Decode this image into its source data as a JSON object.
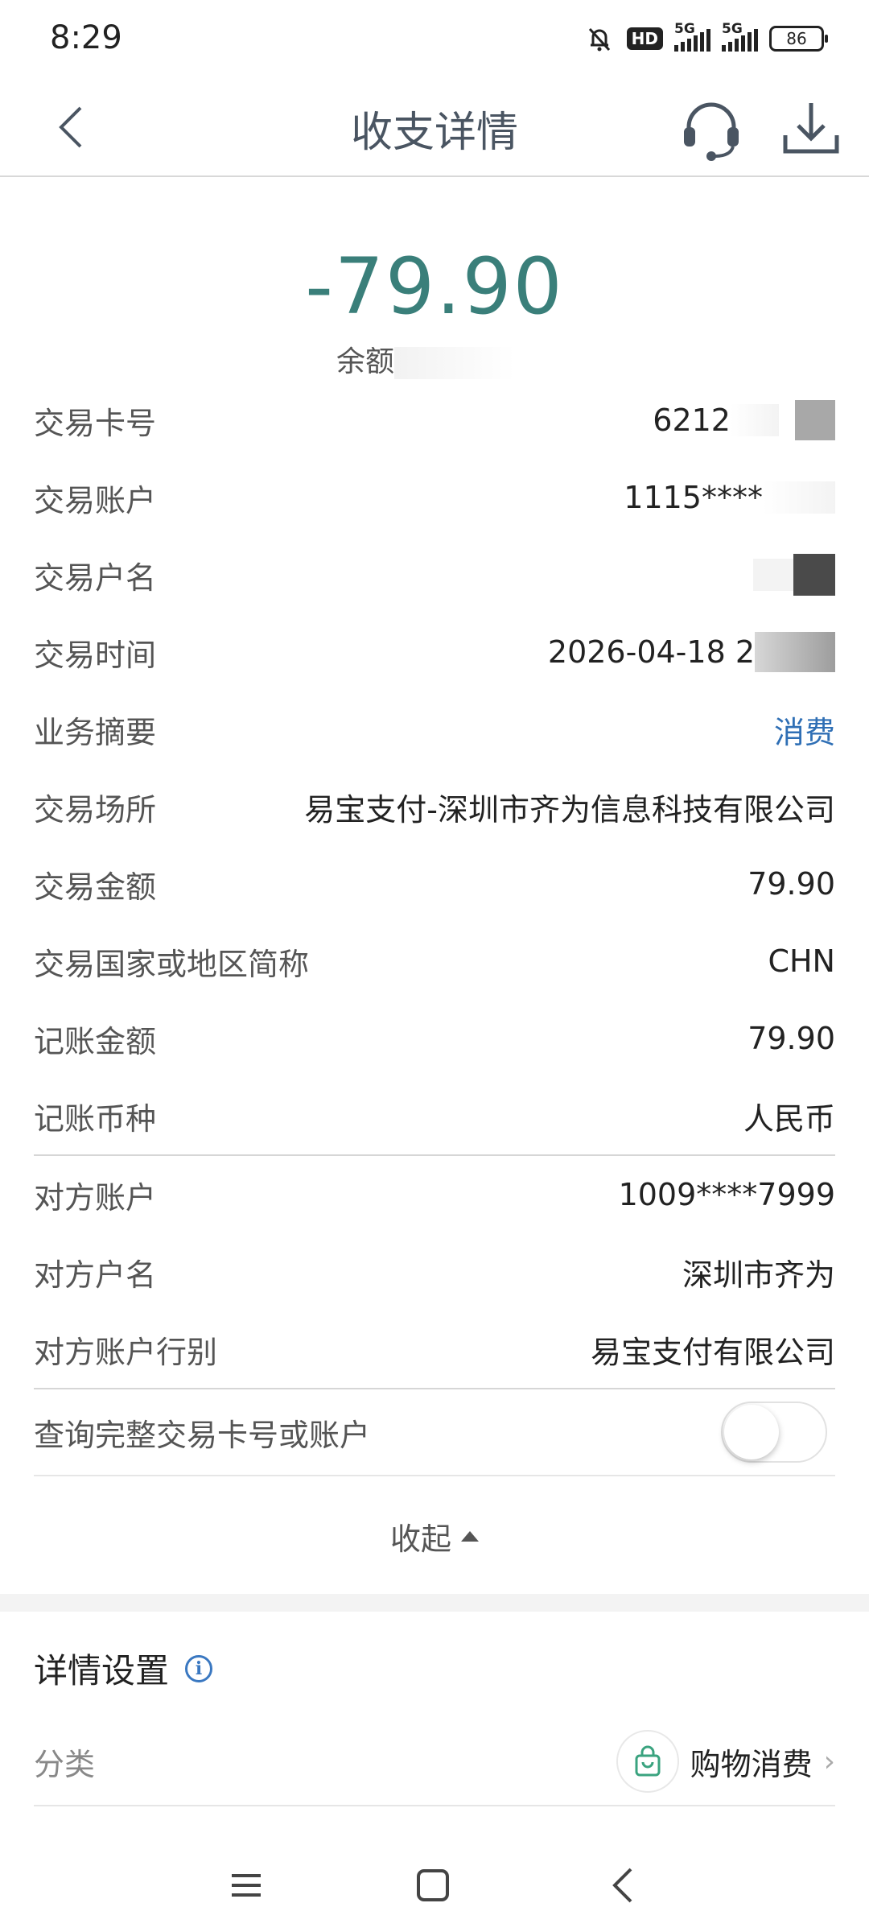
{
  "status_bar": {
    "time": "8:29",
    "hd_label": "HD",
    "sim1_label": "5G",
    "sim2_label": "5G",
    "battery": "86"
  },
  "nav": {
    "title": "收支详情",
    "back_icon": "chevron-left-icon",
    "service_icon": "headset-icon",
    "download_icon": "download-icon"
  },
  "summary": {
    "amount": "-79.90",
    "balance_label": "余额"
  },
  "details": [
    {
      "label": "交易卡号",
      "value": "6212"
    },
    {
      "label": "交易账户",
      "value": "1115****"
    },
    {
      "label": "交易户名",
      "value": ""
    },
    {
      "label": "交易时间",
      "value": "2026-04-18 2"
    },
    {
      "label": "业务摘要",
      "value": "消费"
    },
    {
      "label": "交易场所",
      "value": "易宝支付-深圳市齐为信息科技有限公司"
    },
    {
      "label": "交易金额",
      "value": "79.90"
    },
    {
      "label": "交易国家或地区简称",
      "value": "CHN"
    },
    {
      "label": "记账金额",
      "value": "79.90"
    },
    {
      "label": "记账币种",
      "value": "人民币"
    }
  ],
  "counterparty": [
    {
      "label": "对方账户",
      "value": "1009****7999"
    },
    {
      "label": "对方户名",
      "value": "深圳市齐为"
    },
    {
      "label": "对方账户行别",
      "value": "易宝支付有限公司"
    }
  ],
  "toggle_row": {
    "label": "查询完整交易卡号或账户",
    "enabled": false
  },
  "collapse_label": "收起",
  "settings": {
    "title": "详情设置",
    "category_label": "分类",
    "category_value": "购物消费",
    "category_icon": "shopping-bag-icon"
  },
  "colors": {
    "amount": "#3a7f7a",
    "link": "#2f6fb5",
    "info": "#3a78c1",
    "bag": "#3aa37f"
  }
}
